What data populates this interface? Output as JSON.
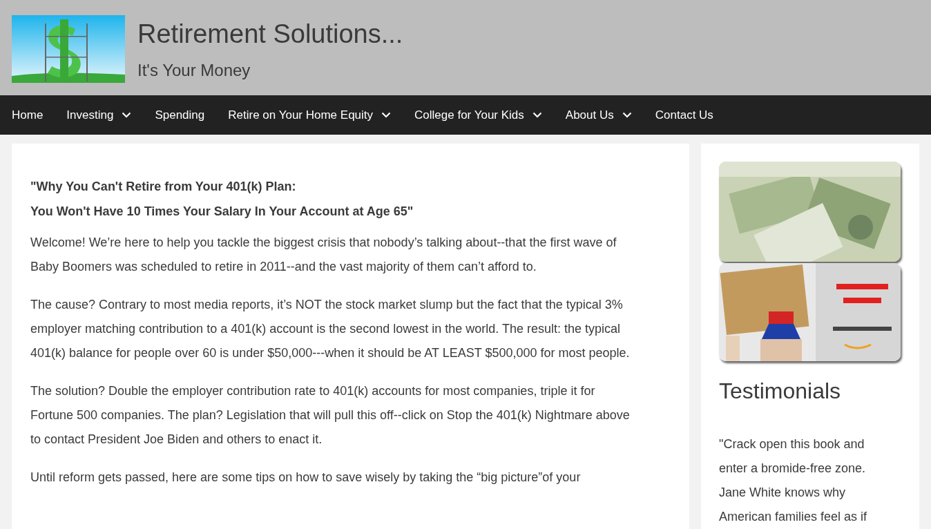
{
  "header": {
    "title": "Retirement Solutions...",
    "tagline": "It's Your Money"
  },
  "nav": [
    {
      "label": "Home",
      "dropdown": false
    },
    {
      "label": "Investing",
      "dropdown": true
    },
    {
      "label": "Spending",
      "dropdown": false
    },
    {
      "label": "Retire on Your Home Equity",
      "dropdown": true
    },
    {
      "label": "College for Your Kids",
      "dropdown": true
    },
    {
      "label": "About Us",
      "dropdown": true
    },
    {
      "label": "Contact Us",
      "dropdown": false
    }
  ],
  "main": {
    "heading": [
      "\"Why You Can't Retire from Your 401(k) Plan:",
      "You Won't Have 10 Times Your Salary In Your Account at Age 65\""
    ],
    "paragraphs": [
      "Welcome! We’re here to help you tackle the biggest crisis that nobody’s talking about--that the first wave of Baby Boomers was scheduled to retire in 2011--and the vast majority of them can’t afford to.",
      "The cause? Contrary to most media reports, it’s NOT the stock market slump but the fact that the typical 3% employer matching contribution to a 401(k) account is the second lowest in the world. The result: the typical 401(k) balance for people over 60 is under $50,000---when it should be AT LEAST $500,000 for most people.",
      "The solution? Double the employer contribution rate to 401(k) accounts for most companies, triple it for Fortune 500 companies. The plan? Legislation that will pull this off--click on Stop the 401(k) Nightmare above to contact President Joe Biden and others to enact it.",
      "Until reform gets passed, here are some tips on how to save wisely by taking the “big picture”of your"
    ]
  },
  "sidebar": {
    "heading": "Testimonials",
    "quote": [
      "\"Crack open this book and",
      "enter a bromide-free zone.",
      "Jane White knows why",
      "American families feel as if"
    ]
  }
}
